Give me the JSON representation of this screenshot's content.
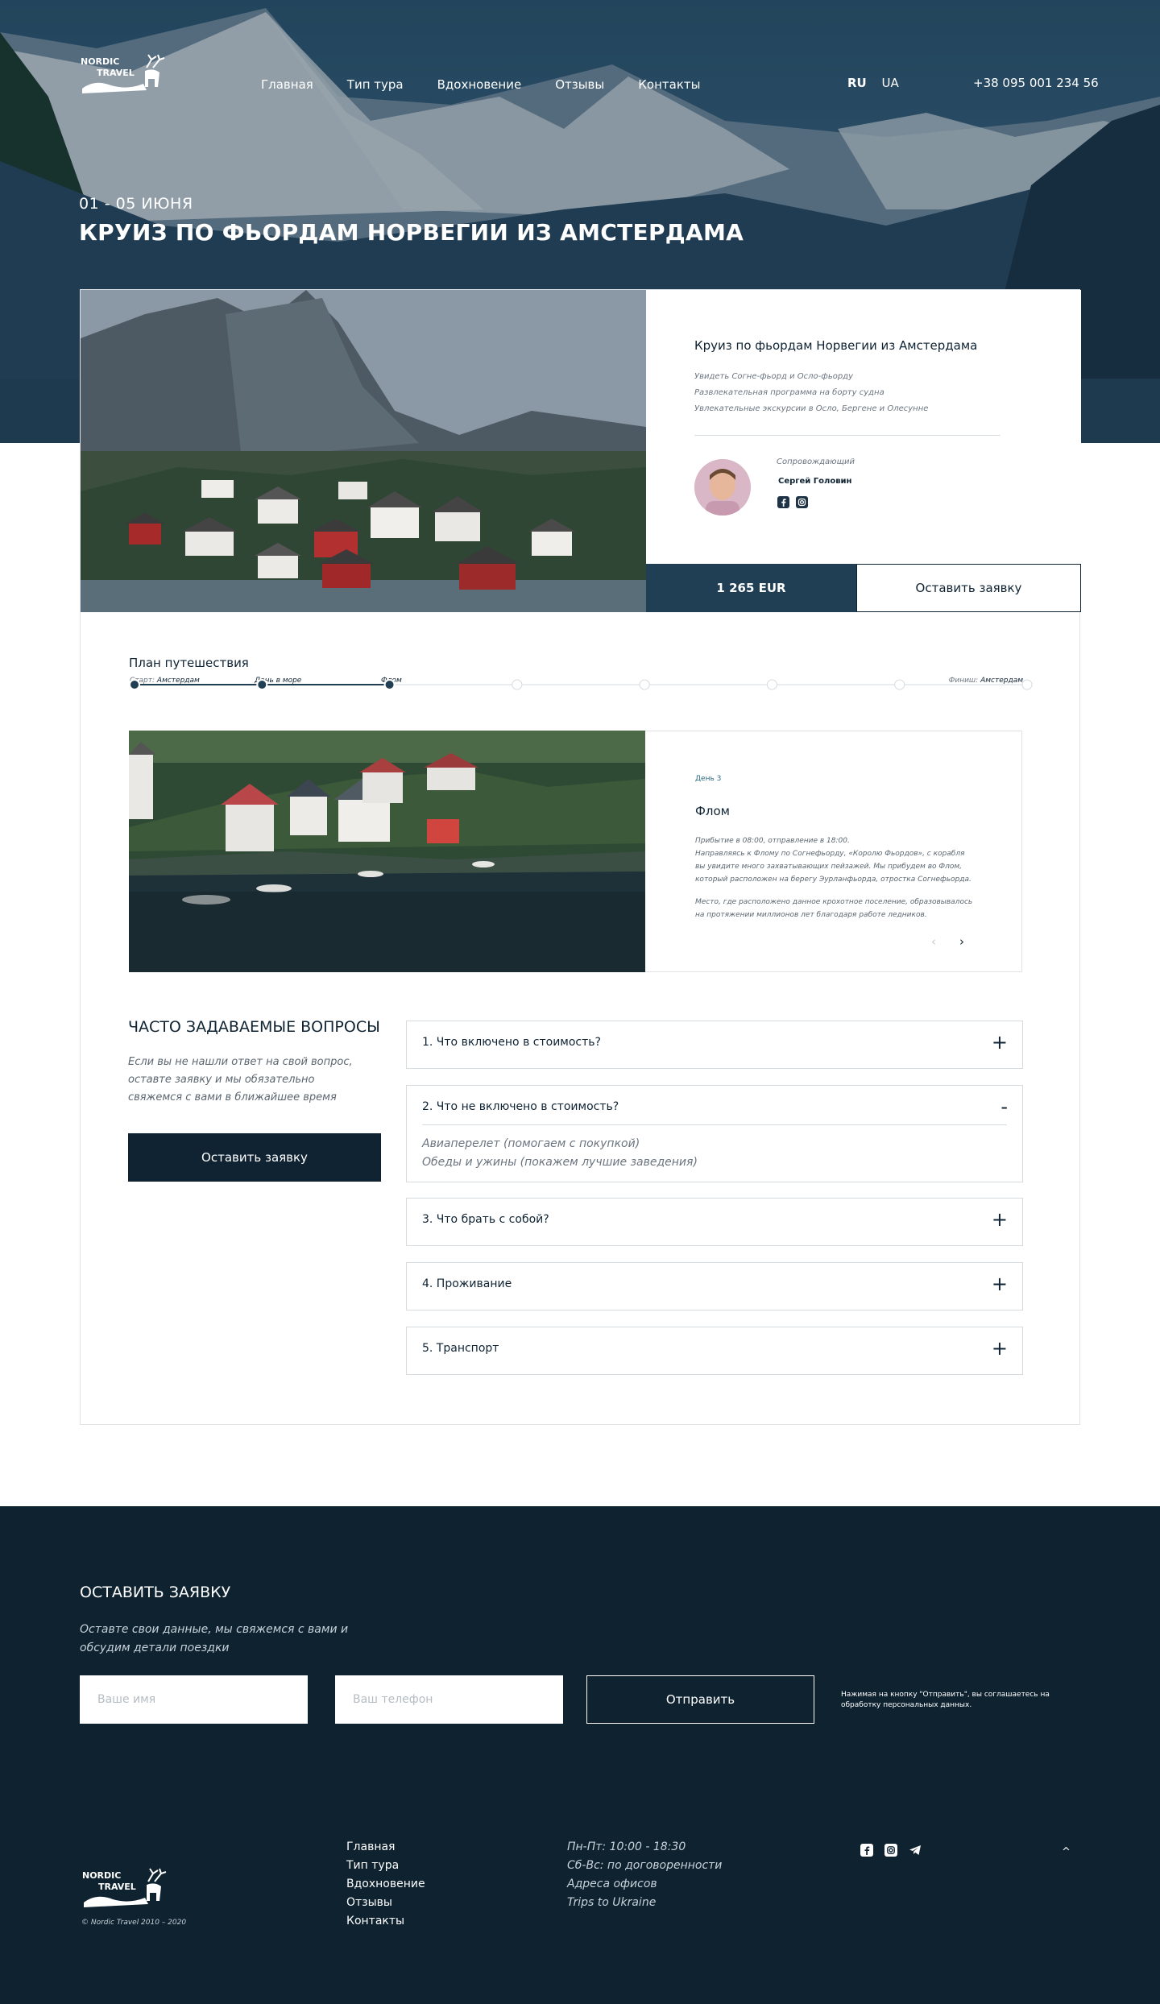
{
  "header": {
    "logo_alt": "Nordic Travel",
    "nav": [
      "Главная",
      "Тип тура",
      "Вдохновение",
      "Отзывы",
      "Контакты"
    ],
    "lang": [
      "RU",
      "UA"
    ],
    "phone": "+38 095 001 234 56"
  },
  "hero": {
    "date": "01 - 05 ИЮНЯ",
    "title": "КРУИЗ  ПО ФЬОРДАМ НОРВЕГИИ ИЗ  АМСТЕРДАМА"
  },
  "tour": {
    "title": "Круиз  по фьордам Норвегии из  Амстердама",
    "features": [
      "Увидеть  Согне-фьорд и Осло-фьорду",
      "Развлекательная программа на борту судна",
      "Увлекательные экскурсии в Осло, Бергене и Олесунне"
    ],
    "guide_role": "Сопровождающий",
    "guide_name": "Сергей Головин",
    "price": "1 265 EUR",
    "apply": "Оставить заявку"
  },
  "plan": {
    "title": "План путешествия",
    "start_label": "Старт:",
    "start_city": "Амстердам",
    "stop2": "День в море",
    "stop3": "Флом",
    "finish_label": "Финиш:",
    "finish_city": "Амстердам",
    "total_stops": 8,
    "active_stops": 3
  },
  "day": {
    "num": "День 3",
    "title": "Флом",
    "paragraph1": [
      "Прибытие в 08:00, отправление в 18:00.",
      "Направляясь к Флому по Согнефьорду, «Королю Фьордов», с корабля",
      "вы увидите много захватывающих пейзажей. Мы прибудем во Флом,",
      "который расположен на берегу Эурланфьорда, отростка Согнефьорда."
    ],
    "paragraph2": [
      "Место, где расположено данное крохотное поселение, образовывалось",
      "на протяжении миллионов лет благодаря работе ледников."
    ],
    "prev": "‹",
    "next": "›"
  },
  "faq": {
    "title": "ЧАСТО ЗАДАВАЕМЫЕ ВОПРОСЫ",
    "note": "Если вы не нашли ответ на свой вопрос, оставте заявку и мы обязательно свяжемся с вами в ближайшее время",
    "apply": "Оставить заявку",
    "items": [
      {
        "q": "1. Что включено в стоимость?",
        "sign": "+"
      },
      {
        "q": "2. Что не включено в стоимость?",
        "sign": "-",
        "answers": [
          "Авиаперелет (помогаем с покупкой)",
          "Обеды и ужины (покажем лучшие заведения)"
        ]
      },
      {
        "q": "3. Что брать с собой?",
        "sign": "+"
      },
      {
        "q": "4. Проживание",
        "sign": "+"
      },
      {
        "q": "5. Транспорт",
        "sign": "+"
      }
    ]
  },
  "footer": {
    "title": "ОСТАВИТЬ ЗАЯВКУ",
    "note": "Оставте свои данные, мы свяжемся с вами и обсудим детали поездки",
    "name_placeholder": "Ваше имя",
    "phone_placeholder": "Ваш телефон",
    "send": "Отправить",
    "consent": "Нажимая на кнопку  \"Отправить\", вы соглашаетесь на обработку персональных данных.",
    "copyright": "© Nordic Travel    2010 – 2020",
    "menu": [
      "Главная",
      "Тип тура",
      "Вдохновение",
      "Отзывы",
      "Контакты"
    ],
    "info": [
      "Пн-Пт: 10:00 - 18:30",
      "Сб-Вс: по договоренности",
      "Адреса офисов",
      "Trips to Ukraine"
    ],
    "up": "^"
  },
  "colors": {
    "dark_navy": "#0e2230",
    "price_bg": "#203f55",
    "accent_blue": "#2a6b86"
  }
}
